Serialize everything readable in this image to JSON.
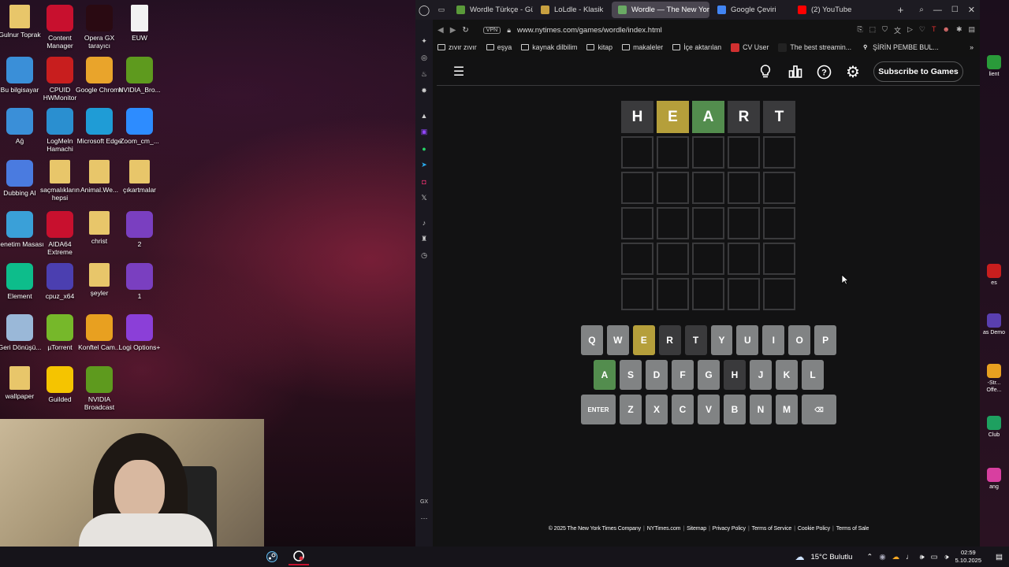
{
  "desktop": {
    "icons": [
      {
        "label": "Gulnur Toprak",
        "icon": "folder-icon",
        "color": "#e8c66a"
      },
      {
        "label": "Content Manager",
        "icon": "content-manager-icon",
        "color": "#c8102e"
      },
      {
        "label": "Opera GX tarayıcı",
        "icon": "opera-gx-icon",
        "color": "#2a0a12"
      },
      {
        "label": "EUW",
        "icon": "text-file-icon",
        "color": "#f2f2f2"
      },
      {
        "label": "Bu bilgisayar",
        "icon": "computer-icon",
        "color": "#3a8fd8"
      },
      {
        "label": "CPUID HWMonitor",
        "icon": "hwmonitor-icon",
        "color": "#c81e1e"
      },
      {
        "label": "Google Chrome",
        "icon": "chrome-icon",
        "color": "#e9a42b"
      },
      {
        "label": "NVIDIA_Bro...",
        "icon": "nvidia-icon",
        "color": "#5e9a1e"
      },
      {
        "label": "Ağ",
        "icon": "network-icon",
        "color": "#3a8fd8"
      },
      {
        "label": "LogMeIn Hamachi",
        "icon": "hamachi-icon",
        "color": "#2a8fd0"
      },
      {
        "label": "Microsoft Edge",
        "icon": "edge-icon",
        "color": "#1f9cd6"
      },
      {
        "label": "Zoom_cm_...",
        "icon": "zoom-icon",
        "color": "#2d8cff"
      },
      {
        "label": "Dubbing AI",
        "icon": "dubbing-ai-icon",
        "color": "#4a7be0"
      },
      {
        "label": "saçmalıkların hepsi",
        "icon": "folder-icon",
        "color": "#e8c66a"
      },
      {
        "label": "Animal.We...",
        "icon": "folder-icon",
        "color": "#e8c66a"
      },
      {
        "label": "çıkartmalar",
        "icon": "folder-icon",
        "color": "#e8c66a"
      },
      {
        "label": "Denetim Masası",
        "icon": "control-panel-icon",
        "color": "#3aa0d8"
      },
      {
        "label": "AIDA64 Extreme",
        "icon": "aida64-icon",
        "color": "#c8102e"
      },
      {
        "label": "christ",
        "icon": "folder-icon",
        "color": "#e8c66a"
      },
      {
        "label": "2",
        "icon": "image-icon",
        "color": "#7a3fc0"
      },
      {
        "label": "Element",
        "icon": "element-icon",
        "color": "#0dbd8b"
      },
      {
        "label": "cpuz_x64",
        "icon": "cpuz-icon",
        "color": "#4b3fb0"
      },
      {
        "label": "şeyler",
        "icon": "folder-icon",
        "color": "#e8c66a"
      },
      {
        "label": "1",
        "icon": "image-icon",
        "color": "#7a3fc0"
      },
      {
        "label": "Geri Dönüşü...",
        "icon": "recycle-bin-icon",
        "color": "#9ab8d8"
      },
      {
        "label": "µTorrent",
        "icon": "utorrent-icon",
        "color": "#76b82a"
      },
      {
        "label": "Konftel Cam...",
        "icon": "konftel-icon",
        "color": "#e8a020"
      },
      {
        "label": "Logi Options+",
        "icon": "logi-icon",
        "color": "#8b3fd8"
      },
      {
        "label": "wallpaper",
        "icon": "folder-icon",
        "color": "#e8c66a"
      },
      {
        "label": "Guilded",
        "icon": "guilded-icon",
        "color": "#f5c400"
      },
      {
        "label": "NVIDIA Broadcast",
        "icon": "nvidia-broadcast-icon",
        "color": "#5e9a1e"
      }
    ]
  },
  "browser": {
    "tabs": [
      {
        "label": "Wordle Türkçe - Gü",
        "icon": "wordle-tr-favicon",
        "color": "#5a9a3a",
        "active": false
      },
      {
        "label": "LoLdle - Klasik",
        "icon": "loldle-favicon",
        "color": "#c8a040",
        "active": false
      },
      {
        "label": "Wordle — The New York",
        "icon": "wordle-favicon",
        "color": "#6aaa64",
        "active": true
      },
      {
        "label": "Google Çeviri",
        "icon": "google-translate-favicon",
        "color": "#4285f4",
        "active": false
      },
      {
        "label": "(2) YouTube",
        "icon": "youtube-favicon",
        "color": "#ff0000",
        "active": false
      }
    ],
    "vpn_label": "VPN",
    "url": "www.nytimes.com/games/wordle/index.html",
    "bookmarks": [
      {
        "label": "zıvır zıvır",
        "icon": "folder-icon"
      },
      {
        "label": "eşya",
        "icon": "folder-icon"
      },
      {
        "label": "kaynak dilbilim",
        "icon": "folder-icon"
      },
      {
        "label": "kitap",
        "icon": "folder-icon"
      },
      {
        "label": "makaleler",
        "icon": "folder-icon"
      },
      {
        "label": "İçe aktarılan",
        "icon": "folder-icon"
      },
      {
        "label": "CV User",
        "icon": "cv-favicon"
      },
      {
        "label": "The best streamin...",
        "icon": "stream-favicon"
      },
      {
        "label": "ŞİRİN PEMBE BUL...",
        "icon": "pin-favicon"
      }
    ]
  },
  "wordle": {
    "subscribe_label": "Subscribe to Games",
    "board": [
      [
        {
          "l": "H",
          "s": "absent"
        },
        {
          "l": "E",
          "s": "present"
        },
        {
          "l": "A",
          "s": "correct"
        },
        {
          "l": "R",
          "s": "absent"
        },
        {
          "l": "T",
          "s": "absent"
        }
      ],
      [
        {
          "l": "",
          "s": "empty"
        },
        {
          "l": "",
          "s": "empty"
        },
        {
          "l": "",
          "s": "empty"
        },
        {
          "l": "",
          "s": "empty"
        },
        {
          "l": "",
          "s": "empty"
        }
      ],
      [
        {
          "l": "",
          "s": "empty"
        },
        {
          "l": "",
          "s": "empty"
        },
        {
          "l": "",
          "s": "empty"
        },
        {
          "l": "",
          "s": "empty"
        },
        {
          "l": "",
          "s": "empty"
        }
      ],
      [
        {
          "l": "",
          "s": "empty"
        },
        {
          "l": "",
          "s": "empty"
        },
        {
          "l": "",
          "s": "empty"
        },
        {
          "l": "",
          "s": "empty"
        },
        {
          "l": "",
          "s": "empty"
        }
      ],
      [
        {
          "l": "",
          "s": "empty"
        },
        {
          "l": "",
          "s": "empty"
        },
        {
          "l": "",
          "s": "empty"
        },
        {
          "l": "",
          "s": "empty"
        },
        {
          "l": "",
          "s": "empty"
        }
      ],
      [
        {
          "l": "",
          "s": "empty"
        },
        {
          "l": "",
          "s": "empty"
        },
        {
          "l": "",
          "s": "empty"
        },
        {
          "l": "",
          "s": "empty"
        },
        {
          "l": "",
          "s": "empty"
        }
      ]
    ],
    "keyboard": [
      [
        {
          "k": "Q",
          "s": ""
        },
        {
          "k": "W",
          "s": ""
        },
        {
          "k": "E",
          "s": "present"
        },
        {
          "k": "R",
          "s": "absent"
        },
        {
          "k": "T",
          "s": "absent"
        },
        {
          "k": "Y",
          "s": ""
        },
        {
          "k": "U",
          "s": ""
        },
        {
          "k": "I",
          "s": ""
        },
        {
          "k": "O",
          "s": ""
        },
        {
          "k": "P",
          "s": ""
        }
      ],
      [
        {
          "k": "A",
          "s": "correct"
        },
        {
          "k": "S",
          "s": ""
        },
        {
          "k": "D",
          "s": ""
        },
        {
          "k": "F",
          "s": ""
        },
        {
          "k": "G",
          "s": ""
        },
        {
          "k": "H",
          "s": "absent"
        },
        {
          "k": "J",
          "s": ""
        },
        {
          "k": "K",
          "s": ""
        },
        {
          "k": "L",
          "s": ""
        }
      ],
      [
        {
          "k": "ENTER",
          "s": "",
          "wide": true
        },
        {
          "k": "Z",
          "s": ""
        },
        {
          "k": "X",
          "s": ""
        },
        {
          "k": "C",
          "s": ""
        },
        {
          "k": "V",
          "s": ""
        },
        {
          "k": "B",
          "s": ""
        },
        {
          "k": "N",
          "s": ""
        },
        {
          "k": "M",
          "s": ""
        },
        {
          "k": "⌫",
          "s": "",
          "wide": true
        }
      ]
    ],
    "footer": [
      "© 2025 The New York Times Company",
      "NYTimes.com",
      "Sitemap",
      "Privacy Policy",
      "Terms of Service",
      "Cookie Policy",
      "Terms of Sale"
    ],
    "colors": {
      "correct": "#538d4e",
      "present": "#b59f3b",
      "absent": "#3a3a3c",
      "key": "#818384"
    }
  },
  "right_strip": [
    {
      "label": "lient",
      "color": "#2a9a3a"
    },
    {
      "label": "es",
      "color": "#c81e1e"
    },
    {
      "label": "as Demo",
      "color": "#5a3fb0"
    },
    {
      "label": "-Str... Offe...",
      "color": "#e8a020"
    },
    {
      "label": "Club",
      "color": "#1ea060"
    },
    {
      "label": "ang",
      "color": "#d83fa0"
    }
  ],
  "taskbar": {
    "weather": "15°C Bulutlu",
    "time": "02:59",
    "date": "5.10.2025"
  }
}
